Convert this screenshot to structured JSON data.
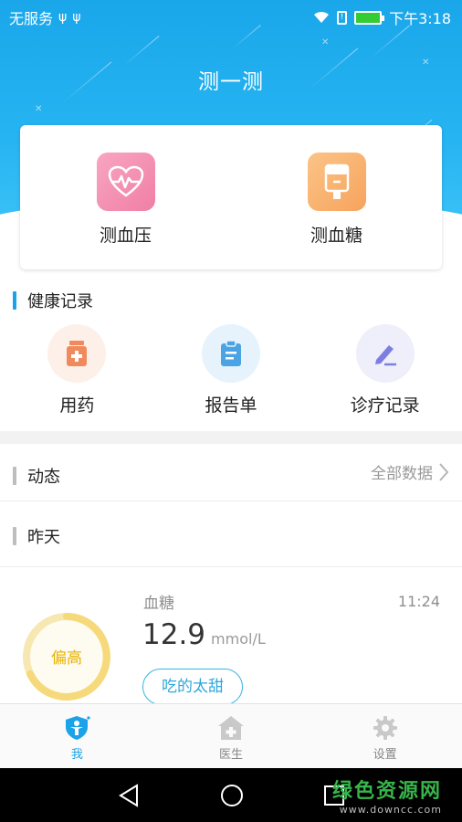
{
  "status_bar": {
    "carrier": "无服务",
    "time": "下午3:18"
  },
  "header": {
    "title": "测一测"
  },
  "measure": {
    "items": [
      {
        "label": "测血压",
        "icon": "heart-rate-icon"
      },
      {
        "label": "测血糖",
        "icon": "glucose-meter-icon"
      }
    ]
  },
  "health_records": {
    "title": "健康记录",
    "items": [
      {
        "label": "用药",
        "icon": "medicine-bottle-icon"
      },
      {
        "label": "报告单",
        "icon": "clipboard-icon"
      },
      {
        "label": "诊疗记录",
        "icon": "edit-pen-icon"
      }
    ]
  },
  "feed": {
    "title": "动态",
    "see_all": "全部数据",
    "group_label": "昨天",
    "reading": {
      "name": "血糖",
      "time": "11:24",
      "value": "12.9",
      "unit": "mmol/L",
      "status": "偏高",
      "note": "吃的太甜"
    }
  },
  "tabbar": {
    "items": [
      {
        "label": "我",
        "icon": "person-shield-icon",
        "active": true
      },
      {
        "label": "医生",
        "icon": "hospital-icon",
        "active": false
      },
      {
        "label": "设置",
        "icon": "gear-icon",
        "active": false
      }
    ]
  },
  "watermark": {
    "title": "绿色资源网",
    "url": "www.downcc.com"
  },
  "colors": {
    "primary": "#1aa3e8",
    "warning": "#e8b200",
    "gauge_ring": "#f5d97a"
  }
}
